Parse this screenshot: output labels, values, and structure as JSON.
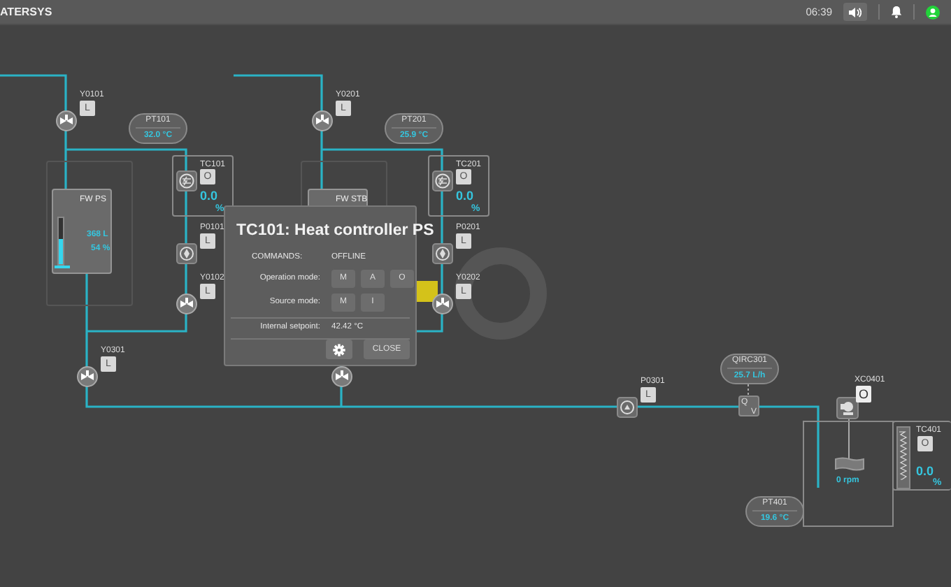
{
  "header": {
    "app_title": "ATERSYS",
    "time": "06:39"
  },
  "tanks": [
    {
      "name": "FW PS",
      "volume": "368 L",
      "percent": "54 %",
      "level": 0.54
    },
    {
      "name": "FW STB"
    }
  ],
  "valves": [
    {
      "tag": "Y0101",
      "mode": "L"
    },
    {
      "tag": "Y0201",
      "mode": "L"
    },
    {
      "tag": "Y0102",
      "mode": "L"
    },
    {
      "tag": "Y0202",
      "mode": "L"
    },
    {
      "tag": "Y0301",
      "mode": "L"
    }
  ],
  "pumps": [
    {
      "tag": "P0101",
      "mode": "L"
    },
    {
      "tag": "P0201",
      "mode": "L"
    },
    {
      "tag": "P0301",
      "mode": "L"
    }
  ],
  "sensors": [
    {
      "tag": "PT101",
      "value": "32.0 °C"
    },
    {
      "tag": "PT201",
      "value": "25.9 °C"
    },
    {
      "tag": "QIRC301",
      "value": "25.7 L/h"
    },
    {
      "tag": "PT401",
      "value": "19.6 °C"
    }
  ],
  "controllers": [
    {
      "tag": "TC101",
      "mode": "O",
      "output": "0.0",
      "unit": "%"
    },
    {
      "tag": "TC201",
      "mode": "O",
      "output": "0.0",
      "unit": "%"
    },
    {
      "tag": "TC401",
      "mode": "O",
      "output": "0.0",
      "unit": "%"
    }
  ],
  "flow_meter": {
    "top": "Q",
    "bottom": "V"
  },
  "agitator": {
    "tag": "XC0401",
    "mode": "O",
    "speed": "0 rpm"
  },
  "dialog": {
    "title": "TC101: Heat controller PS",
    "commands_label": "COMMANDS:",
    "commands_status": "OFFLINE",
    "rows": [
      {
        "label": "Operation mode:",
        "buttons": [
          "M",
          "A",
          "O"
        ]
      },
      {
        "label": "Source mode:",
        "buttons": [
          "M",
          "I"
        ]
      }
    ],
    "setpoint_label": "Internal setpoint:",
    "setpoint_value": "42.42 °C",
    "close": "CLOSE"
  }
}
